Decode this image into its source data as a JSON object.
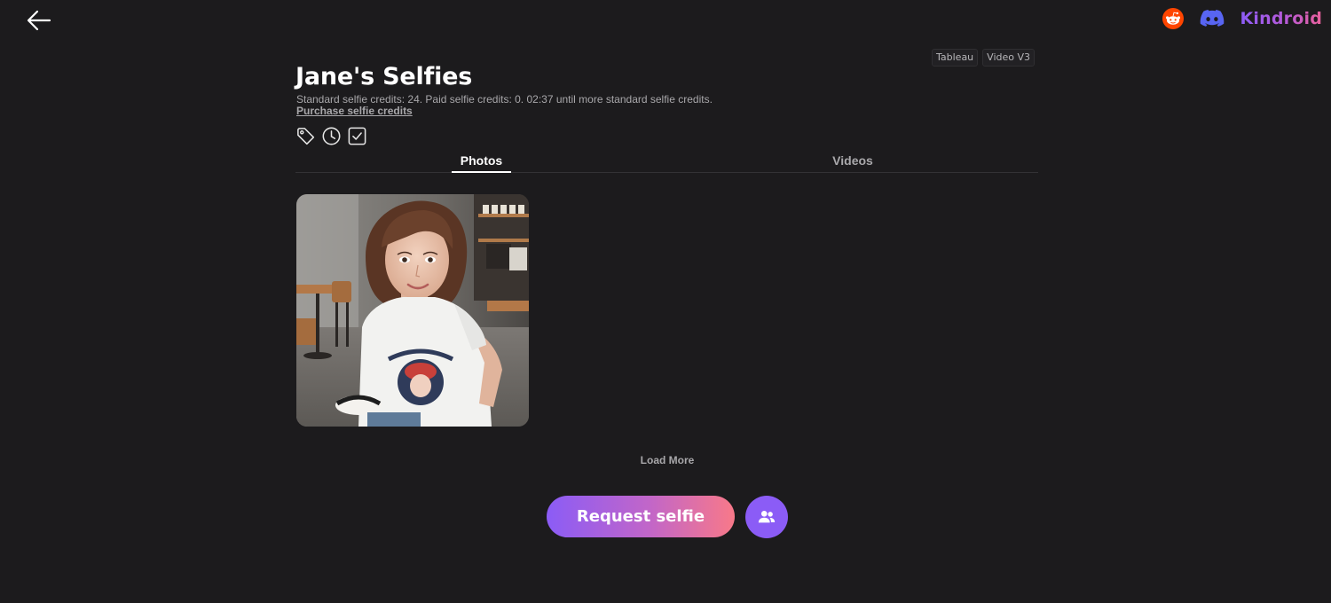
{
  "header": {
    "back_icon": "arrow-left-icon",
    "social": [
      {
        "name": "reddit",
        "icon": "reddit-icon",
        "color": "#ff4500"
      },
      {
        "name": "discord",
        "icon": "discord-icon",
        "color": "#5865f2"
      }
    ],
    "brand": "Kindroid"
  },
  "mode_chips": [
    "Tableau",
    "Video V3"
  ],
  "page": {
    "title": "Jane's Selfies",
    "credits_text": "Standard selfie credits: 24. Paid selfie credits: 0. 02:37 until more standard selfie credits.",
    "purchase_link": "Purchase selfie credits"
  },
  "filters": [
    {
      "icon": "tag-icon"
    },
    {
      "icon": "clock-icon"
    },
    {
      "icon": "checkbox-icon"
    }
  ],
  "tabs": [
    {
      "label": "Photos",
      "active": true
    },
    {
      "label": "Videos",
      "active": false
    }
  ],
  "gallery": {
    "items": [
      {
        "type": "photo",
        "subject": "selfie-in-cafe"
      }
    ]
  },
  "load_more": "Load More",
  "actions": {
    "request_label": "Request selfie",
    "group_icon": "group-icon"
  },
  "colors": {
    "background": "#1c1b1d",
    "accent_purple": "#8b5cf6",
    "accent_pink": "#f87989",
    "muted_text": "#a8a7aa"
  }
}
